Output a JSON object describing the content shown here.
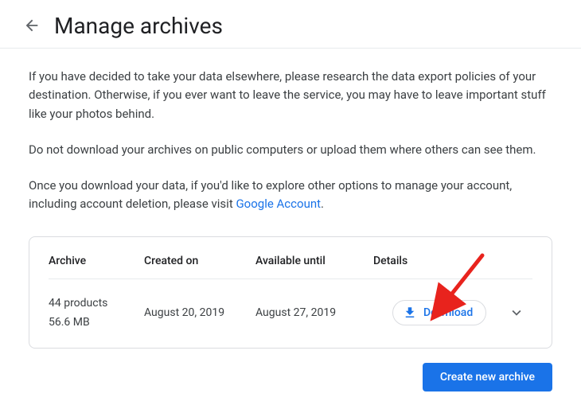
{
  "header": {
    "title": "Manage archives"
  },
  "intro": {
    "p1": "If you have decided to take your data elsewhere, please research the data export policies of your destination. Otherwise, if you ever want to leave the service, you may have to leave important stuff like your photos behind.",
    "p2": "Do not download your archives on public computers or upload them where others can see them.",
    "p3_prefix": "Once you download your data, if you'd like to explore other options to manage your account, including account deletion, please visit ",
    "p3_link": "Google Account",
    "p3_suffix": "."
  },
  "table": {
    "headers": {
      "archive": "Archive",
      "created": "Created on",
      "available": "Available until",
      "details": "Details"
    },
    "row": {
      "archive_line1": "44 products",
      "archive_line2": "56.6 MB",
      "created": "August 20, 2019",
      "available": "August 27, 2019",
      "download_label": "Download"
    }
  },
  "actions": {
    "create": "Create new archive"
  }
}
